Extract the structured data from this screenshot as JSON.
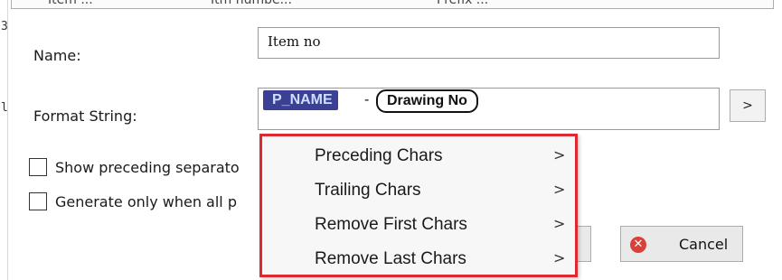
{
  "dialog": {
    "top_strip_fragments": [
      "Item ...",
      "Itm numbe...",
      "Prefix ..."
    ],
    "left_edge_glyphs": [
      "3",
      "l"
    ]
  },
  "name_field": {
    "label": "Name:",
    "value": "Item no"
  },
  "format_field": {
    "label": "Format String:",
    "tokens": [
      {
        "text": "P_NAME",
        "selected": true
      },
      {
        "text": "-",
        "kind": "separator"
      },
      {
        "text": "Drawing No",
        "selected": false
      }
    ],
    "more_button_label": ">"
  },
  "options": {
    "show_separator_label": "Show preceding separato",
    "show_separator_checked": false,
    "generate_label": "Generate only when all p",
    "generate_checked": false
  },
  "buttons": {
    "cancel_label": "Cancel",
    "cancel_icon": "close-circle-icon"
  },
  "context_menu": {
    "items": [
      {
        "label": "Preceding Chars",
        "submenu": ">"
      },
      {
        "label": "Trailing Chars",
        "submenu": ">"
      },
      {
        "label": "Remove First Chars",
        "submenu": ">"
      },
      {
        "label": "Remove Last Chars",
        "submenu": ">"
      }
    ],
    "highlight_color": "#e0282f"
  },
  "colors": {
    "selected_token_bg": "#3b3f95",
    "cancel_icon": "#d9403a"
  }
}
